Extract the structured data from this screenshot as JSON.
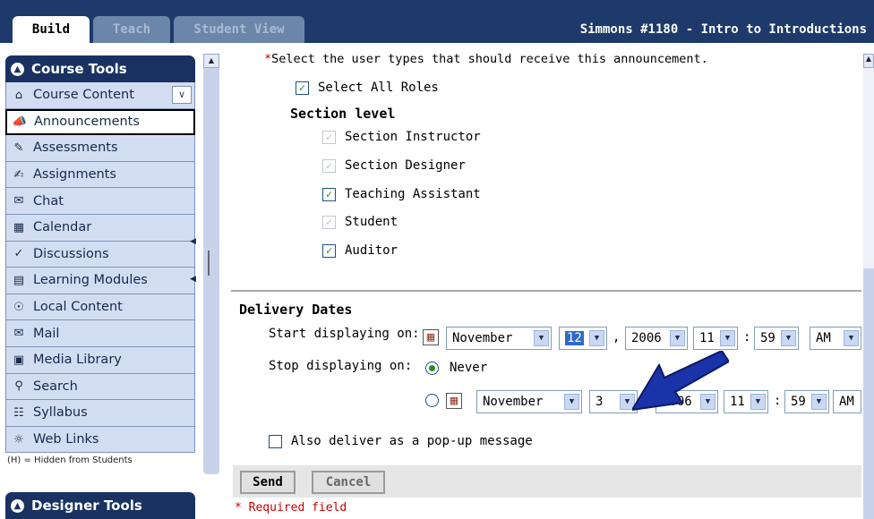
{
  "tabs": {
    "build": "Build",
    "teach": "Teach",
    "student": "Student View"
  },
  "course_title": "Simmons #1180 - Intro to Introductions",
  "sidebar": {
    "header": "Course Tools",
    "items": [
      {
        "label": "Course Content",
        "icon": "home-icon"
      },
      {
        "label": "Announcements",
        "icon": "megaphone-icon"
      },
      {
        "label": "Assessments",
        "icon": "assessment-icon"
      },
      {
        "label": "Assignments",
        "icon": "assignment-icon"
      },
      {
        "label": "Chat",
        "icon": "chat-icon"
      },
      {
        "label": "Calendar",
        "icon": "calendar-icon"
      },
      {
        "label": "Discussions",
        "icon": "discussion-icon"
      },
      {
        "label": "Learning Modules",
        "icon": "module-icon"
      },
      {
        "label": "Local Content",
        "icon": "local-content-icon"
      },
      {
        "label": "Mail",
        "icon": "mail-icon"
      },
      {
        "label": "Media Library",
        "icon": "media-library-icon"
      },
      {
        "label": "Search",
        "icon": "search-icon"
      },
      {
        "label": "Syllabus",
        "icon": "syllabus-icon"
      },
      {
        "label": "Web Links",
        "icon": "web-links-icon"
      }
    ],
    "hidden_note": "(H) = Hidden from Students",
    "designer_header": "Designer Tools"
  },
  "roles": {
    "prompt": "Select the user types that should receive this announcement.",
    "select_all": "Select All Roles",
    "section_title": "Section level",
    "items": [
      {
        "label": "Section Instructor",
        "checked": true,
        "disabled": true
      },
      {
        "label": "Section Designer",
        "checked": true,
        "disabled": true
      },
      {
        "label": "Teaching Assistant",
        "checked": true,
        "disabled": false
      },
      {
        "label": "Student",
        "checked": true,
        "disabled": true
      },
      {
        "label": "Auditor",
        "checked": true,
        "disabled": false
      }
    ]
  },
  "delivery": {
    "title": "Delivery Dates",
    "start_label": "Start displaying on:",
    "start": {
      "month": "November",
      "day": "12",
      "year": "2006",
      "hour": "11",
      "minute": "59",
      "ampm": "AM"
    },
    "stop_label": "Stop displaying on:",
    "never_label": "Never",
    "stop": {
      "month": "November",
      "day": "3",
      "year": "2006",
      "hour": "11",
      "minute": "59",
      "ampm": "AM"
    },
    "popup_label": "Also deliver as a pop-up message"
  },
  "buttons": {
    "send": "Send",
    "cancel": "Cancel"
  },
  "required_field": "* Required field",
  "colors": {
    "topbar": "#1d3a6b",
    "nav_bg": "#d3ddf2",
    "arrow": "#1a33a8"
  }
}
